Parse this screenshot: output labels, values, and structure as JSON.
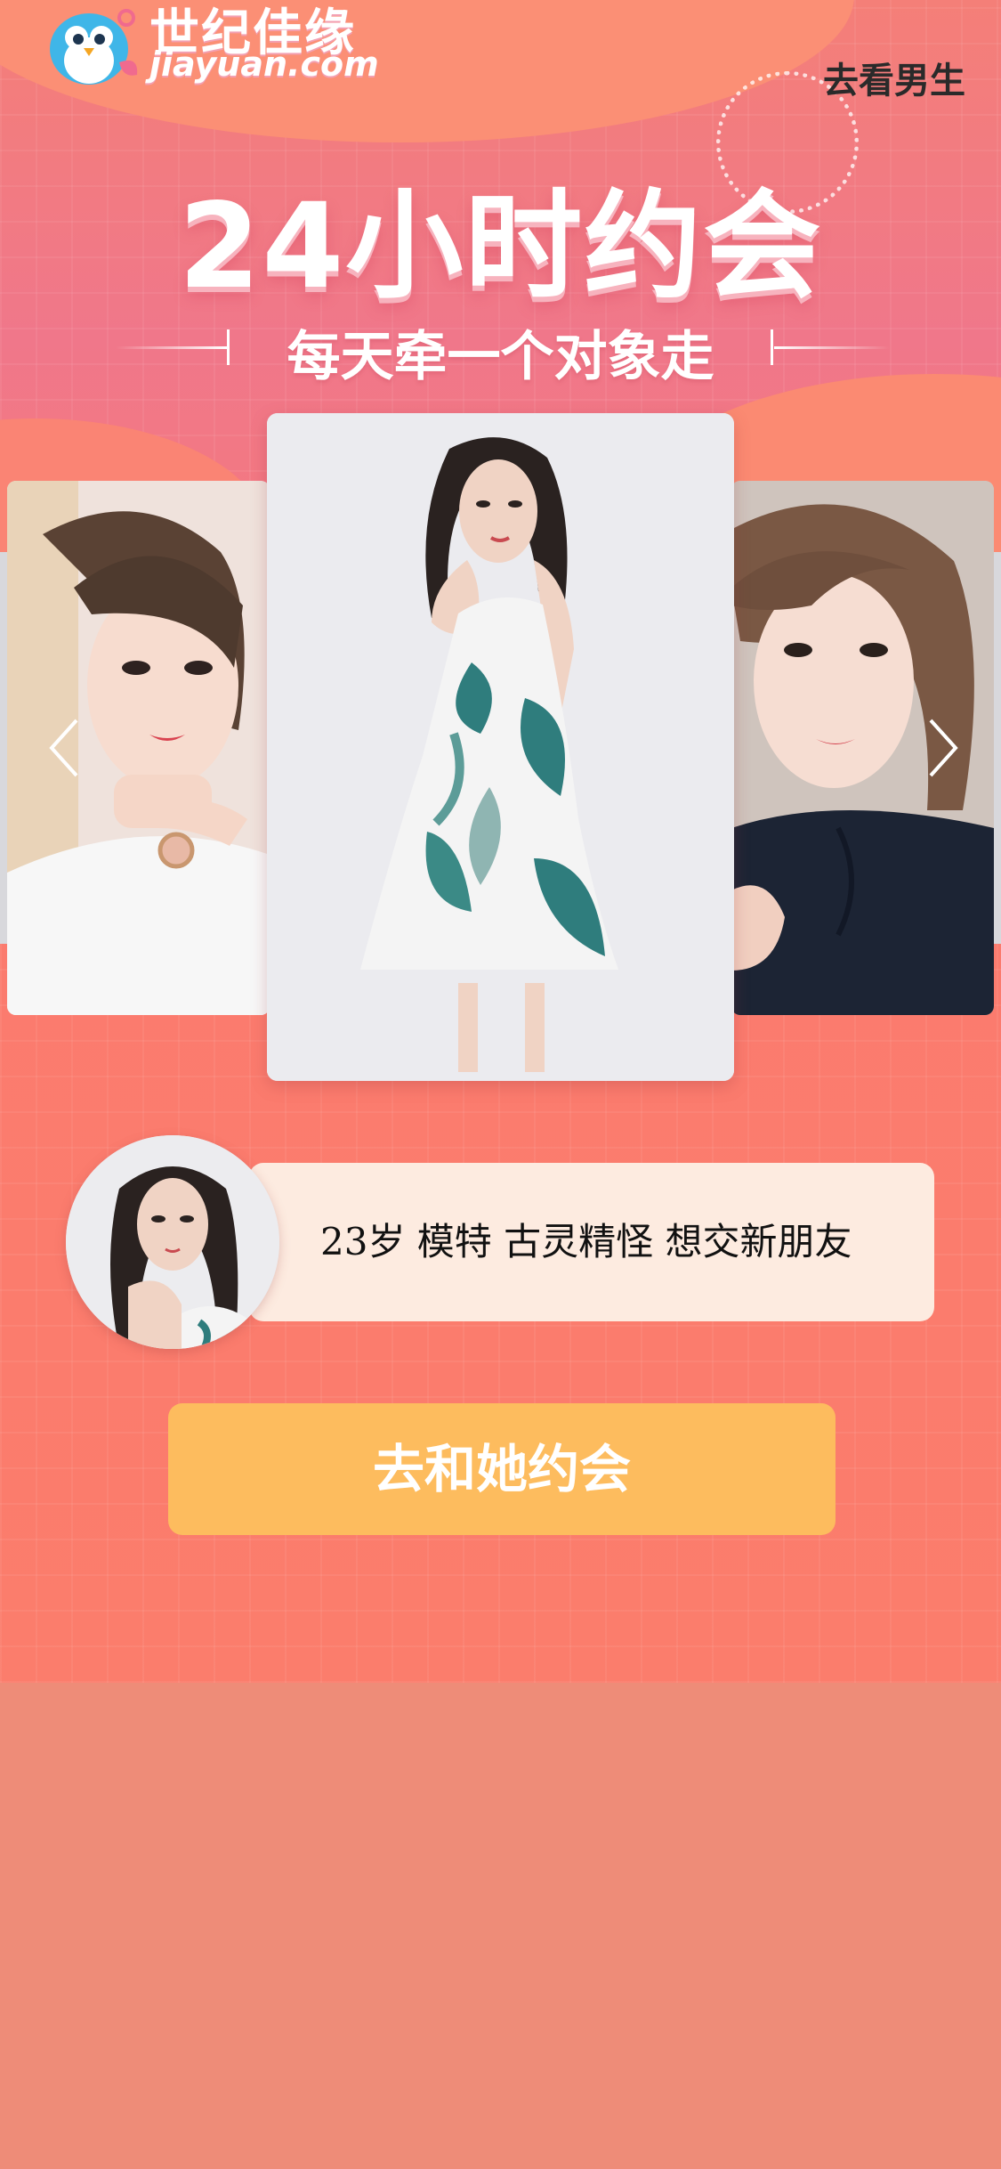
{
  "brand": {
    "name_cn": "世纪佳缘",
    "name_en": "jiayuan.com"
  },
  "nav": {
    "go_male_label": "去看男生"
  },
  "hero": {
    "title": "24小时约会",
    "subtitle": "每天牵一个对象走"
  },
  "carousel": {
    "prev_icon": "chevron-left-icon",
    "next_icon": "chevron-right-icon"
  },
  "profile": {
    "description": "23岁 模特 古灵精怪 想交新朋友"
  },
  "cta": {
    "label": "去和她约会"
  },
  "colors": {
    "background": "#fb7d6c",
    "bottom_background": "#ee8c78",
    "cta_background": "#fdbc5e",
    "profile_box": "#fdebe0"
  }
}
